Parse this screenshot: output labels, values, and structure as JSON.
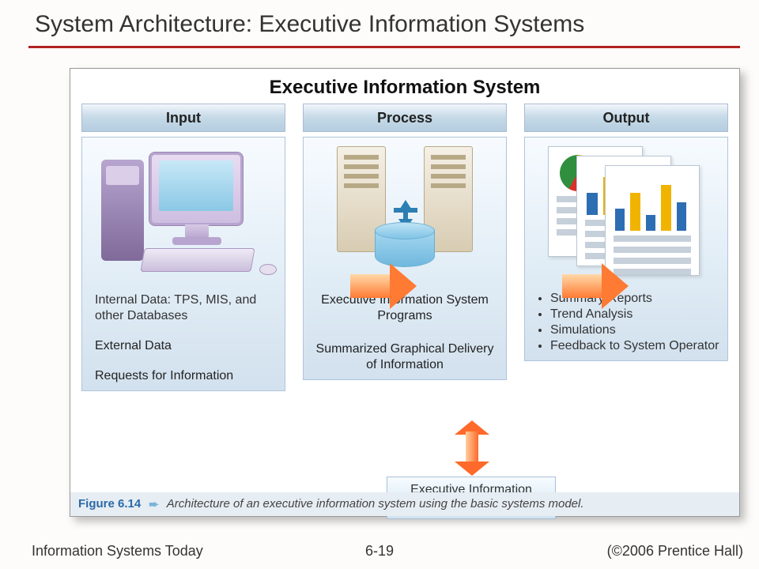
{
  "slide_title": "System Architecture: Executive Information Systems",
  "figure": {
    "title": "Executive Information System",
    "columns": {
      "input": {
        "header": "Input",
        "box_text": "Internal Data: TPS, MIS, and other Databases",
        "extra1": "External Data",
        "extra2": "Requests for Information"
      },
      "process": {
        "header": "Process",
        "box_text": "Executive Information System Programs",
        "extra1": "Summarized Graphical Delivery of Information"
      },
      "output": {
        "header": "Output",
        "bullet1": "Summary Reports",
        "bullet2": "Trend Analysis",
        "bullet3": "Simulations",
        "bullet4": "Feedback to System Operator"
      }
    },
    "eis_data_box": "Executive Information System Data",
    "caption_number": "Figure 6.14",
    "caption_arrow": "➨",
    "caption_text": "Architecture of an executive information system using the basic systems model."
  },
  "footer": {
    "left": "Information Systems Today",
    "center": "6-19",
    "right": "(©2006 Prentice Hall)"
  }
}
